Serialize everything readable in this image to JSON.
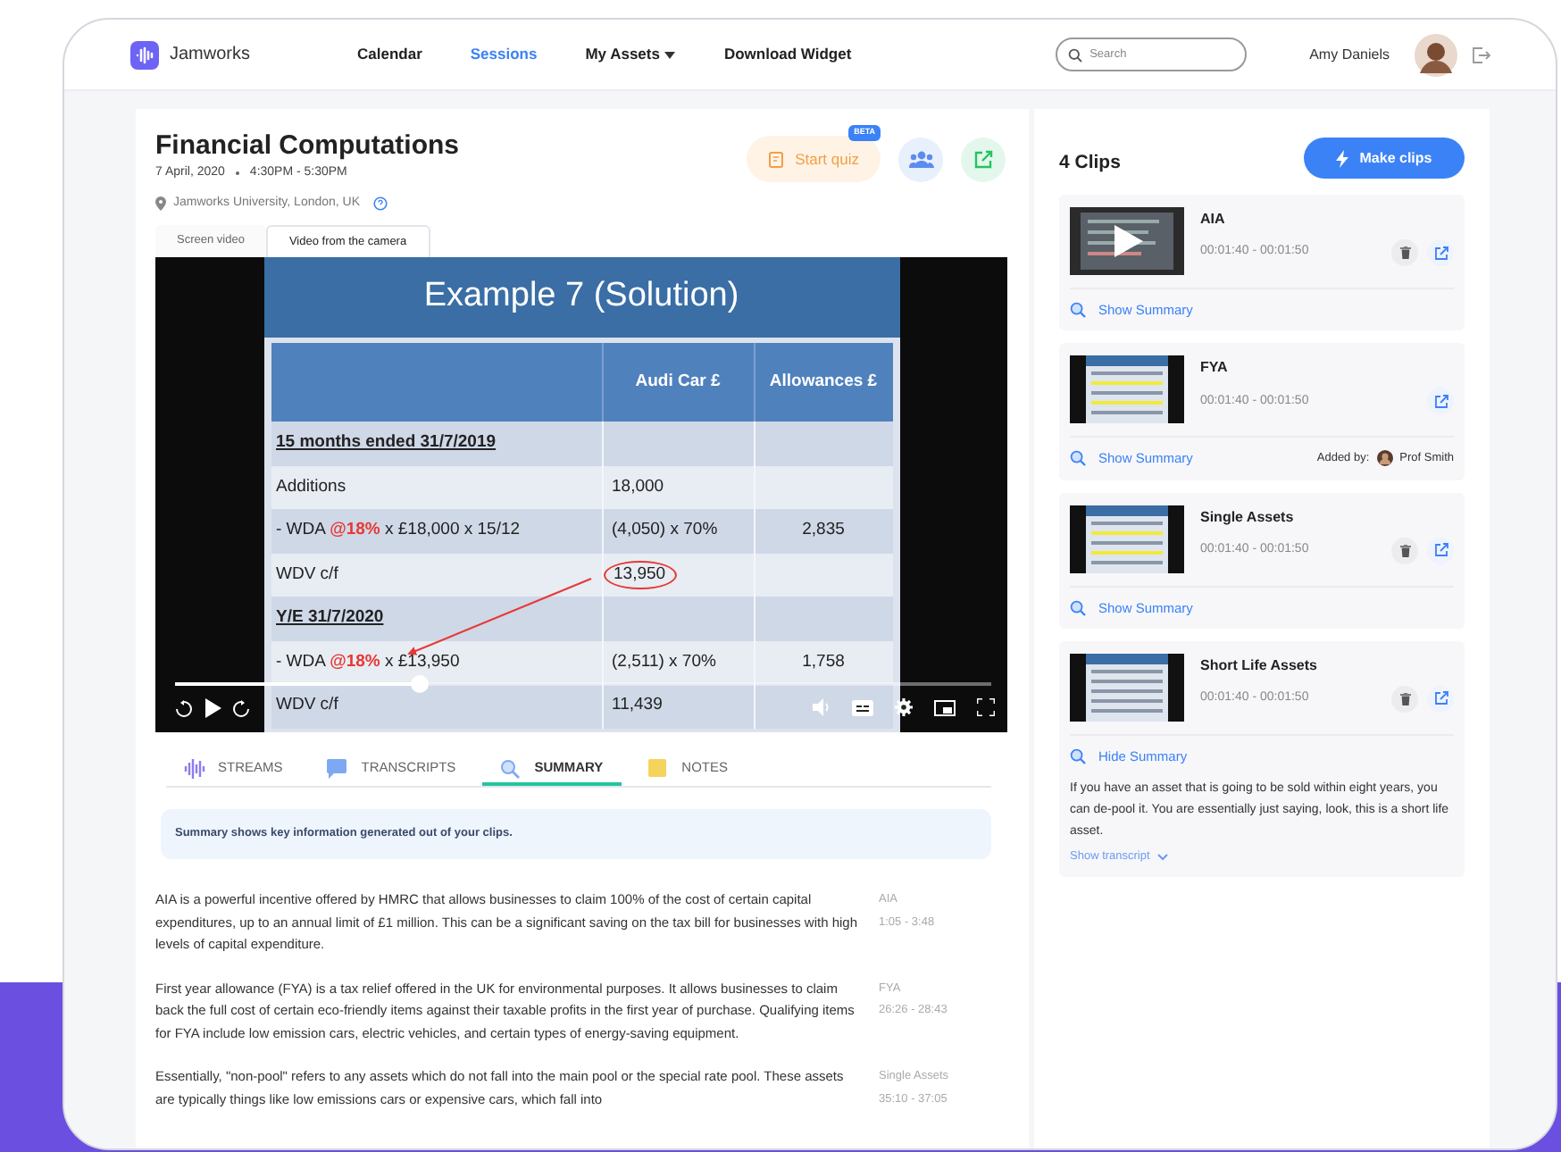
{
  "header": {
    "logo": "Jamworks",
    "nav": [
      {
        "label": "Calendar",
        "selected": false,
        "dropdown": false
      },
      {
        "label": "Sessions",
        "selected": true,
        "dropdown": false
      },
      {
        "label": "My Assets",
        "selected": false,
        "dropdown": true
      },
      {
        "label": "Download Widget",
        "selected": false,
        "dropdown": false
      }
    ],
    "search": {
      "placeholder": "Search"
    },
    "user_name": "Amy Daniels"
  },
  "session": {
    "title": "Financial Computations",
    "date": "7 April, 2020",
    "time": "4:30PM - 5:30PM",
    "location": "Jamworks University, London, UK",
    "start_quiz": "Start quiz",
    "badge": "BETA",
    "video_tabs": [
      {
        "label": "Screen video",
        "selected": false
      },
      {
        "label": "Video from the camera",
        "selected": true
      }
    ],
    "slide": {
      "title": "Example 7 (Solution)",
      "columns": [
        "",
        "Audi Car £",
        "Allowances £"
      ],
      "rows": [
        {
          "kind": "section",
          "cells": [
            [
              {
                "text": "15 months ended 31/7/2019"
              }
            ],
            [],
            []
          ]
        },
        {
          "kind": "line",
          "cells": [
            [
              {
                "text": "Additions"
              }
            ],
            [
              {
                "text": "18,000"
              }
            ],
            []
          ]
        },
        {
          "kind": "line",
          "cells": [
            [
              {
                "text": "- WDA "
              },
              {
                "text": "@18%",
                "red": true
              },
              {
                "text": " x £18,000 x 15/12"
              }
            ],
            [
              {
                "text": "(4,050) x 70%"
              }
            ],
            [
              {
                "text": "2,835"
              }
            ]
          ]
        },
        {
          "kind": "line",
          "cells": [
            [
              {
                "text": "WDV c/f"
              }
            ],
            [
              {
                "text": "13,950",
                "circled": true
              }
            ],
            []
          ]
        },
        {
          "kind": "section",
          "cells": [
            [
              {
                "text": "Y/E 31/7/2020"
              }
            ],
            [],
            []
          ]
        },
        {
          "kind": "line",
          "cells": [
            [
              {
                "text": "- WDA "
              },
              {
                "text": "@18%",
                "red": true
              },
              {
                "text": " x £13,950"
              }
            ],
            [
              {
                "text": "(2,511) x 70%"
              }
            ],
            [
              {
                "text": "1,758"
              }
            ]
          ]
        },
        {
          "kind": "line",
          "cells": [
            [
              {
                "text": "WDV c/f"
              }
            ],
            [
              {
                "text": "11,439"
              }
            ],
            []
          ]
        }
      ]
    },
    "progress": {
      "level": 0.3
    },
    "tabs": [
      {
        "label": "STREAMS",
        "kind": "streams",
        "selected": false
      },
      {
        "label": "TRANSCRIPTS",
        "kind": "transcripts",
        "selected": false
      },
      {
        "label": "SUMMARY",
        "kind": "summary",
        "selected": true
      },
      {
        "label": "NOTES",
        "kind": "notes",
        "selected": false
      }
    ],
    "info": "Summary shows key information generated out of your clips.",
    "summaries": [
      {
        "text": "AIA is a powerful incentive offered by HMRC that allows businesses to claim 100% of the cost of certain capital expenditures, up to an annual limit of £1 million. This can be a significant saving on the tax bill for businesses with high levels of capital expenditure.",
        "clip": "AIA",
        "range": "1:05 - 3:48"
      },
      {
        "text": "First year allowance (FYA) is a tax relief offered in the UK for environmental purposes. It allows businesses to claim back the full cost of certain eco-friendly items against their taxable profits in the first year of purchase. Qualifying items for FYA include low emission cars, electric vehicles, and certain types of energy-saving equipment.",
        "clip": "FYA",
        "range": "26:26 - 28:43"
      },
      {
        "text": "Essentially, \"non-pool\" refers to any assets which do not fall into the main pool or the special rate pool. These assets are typically things like low emissions cars or expensive cars, which fall into",
        "clip": "Single Assets",
        "range": "35:10 - 37:05"
      }
    ]
  },
  "clips_panel": {
    "title": "4 Clips",
    "make_clips": "Make clips",
    "clips": [
      {
        "title": "AIA",
        "range": "00:01:40 - 00:01:50",
        "deletable": true,
        "playing": true,
        "summary_toggle": "Show Summary"
      },
      {
        "title": "FYA",
        "range": "00:01:40 - 00:01:50",
        "deletable": false,
        "playing": false,
        "summary_toggle": "Show Summary",
        "added_by_label": "Added by:",
        "added_by": "Prof Smith"
      },
      {
        "title": "Single Assets",
        "range": "00:01:40 - 00:01:50",
        "deletable": true,
        "playing": false,
        "summary_toggle": "Show Summary"
      },
      {
        "title": "Short Life Assets",
        "range": "00:01:40 - 00:01:50",
        "deletable": true,
        "playing": false,
        "summary_toggle": "Hide Summary",
        "summary": "If you have an asset that is going to be sold within eight years, you can de-pool it. You are essentially just saying, look, this is a short life asset.",
        "transcript_link": "Show transcript"
      }
    ]
  }
}
